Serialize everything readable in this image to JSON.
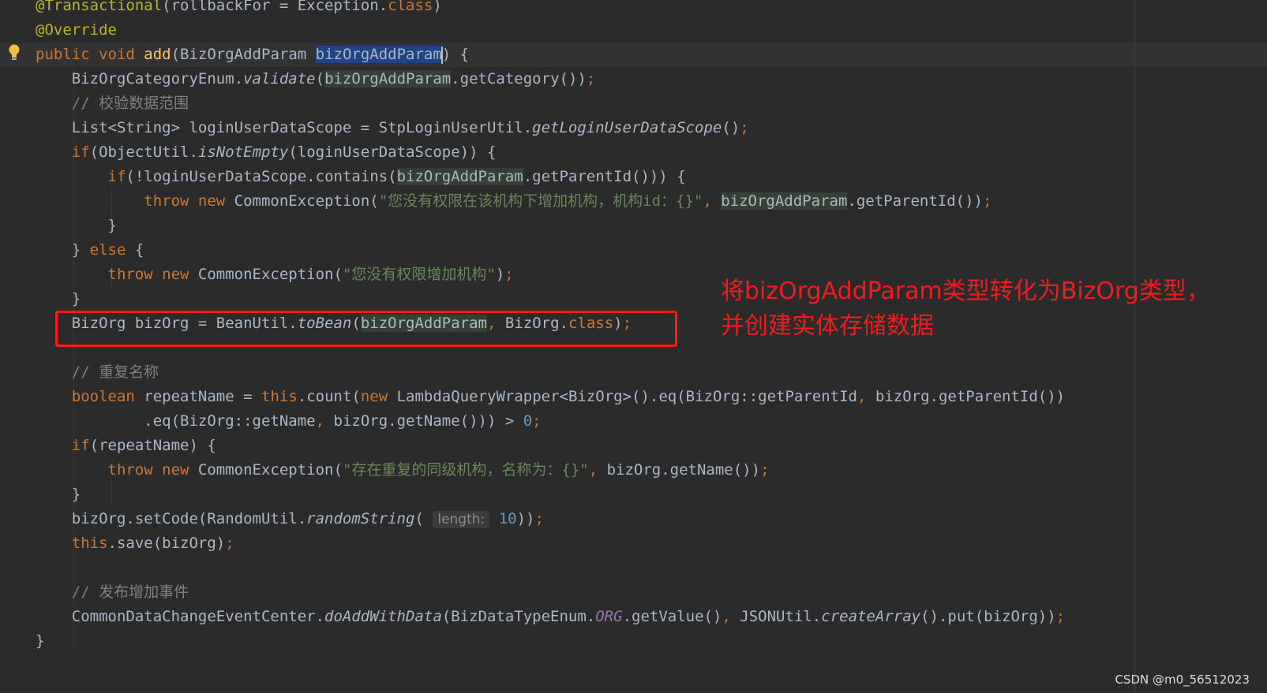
{
  "editor": {
    "lines": [
      [
        {
          "t": "@Transactional",
          "c": "ann"
        },
        {
          "t": "(rollbackFor = Exception."
        },
        {
          "t": "class",
          "c": "k"
        },
        {
          "t": ")"
        }
      ],
      [
        {
          "t": "@Override",
          "c": "ann"
        }
      ],
      [
        {
          "t": "public void ",
          "c": "k"
        },
        {
          "t": "add",
          "c": "fn"
        },
        {
          "t": "(BizOrgAddParam "
        },
        {
          "t": "bizOrgAddParam",
          "c": "hl-sel",
          "caret": true
        },
        {
          "t": ") {"
        }
      ],
      [
        {
          "t": "    BizOrgCategoryEnum."
        },
        {
          "t": "validate",
          "c": "it"
        },
        {
          "t": "("
        },
        {
          "t": "bizOrgAddParam",
          "c": "hl-usage"
        },
        {
          "t": ".getCategory())"
        },
        {
          "t": ";",
          "c": "k"
        }
      ],
      [
        {
          "t": "    // 校验数据范围",
          "c": "cm"
        }
      ],
      [
        {
          "t": "    List<String> loginUserDataScope = StpLoginUserUtil."
        },
        {
          "t": "getLoginUserDataScope",
          "c": "it"
        },
        {
          "t": "()"
        },
        {
          "t": ";",
          "c": "k"
        }
      ],
      [
        {
          "t": "    "
        },
        {
          "t": "if",
          "c": "k"
        },
        {
          "t": "(ObjectUtil."
        },
        {
          "t": "isNotEmpty",
          "c": "it"
        },
        {
          "t": "(loginUserDataScope)) {"
        }
      ],
      [
        {
          "t": "        "
        },
        {
          "t": "if",
          "c": "k"
        },
        {
          "t": "(!loginUserDataScope.contains("
        },
        {
          "t": "bizOrgAddParam",
          "c": "hl-usage"
        },
        {
          "t": ".getParentId())) {"
        }
      ],
      [
        {
          "t": "            "
        },
        {
          "t": "throw new ",
          "c": "k"
        },
        {
          "t": "CommonException("
        },
        {
          "t": "\"您没有权限在该机构下增加机构，机构id：{}\"",
          "c": "str"
        },
        {
          "t": ", ",
          "c": "k"
        },
        {
          "t": "bizOrgAddParam",
          "c": "hl-usage"
        },
        {
          "t": ".getParentId())"
        },
        {
          "t": ";",
          "c": "k"
        }
      ],
      [
        {
          "t": "        }"
        }
      ],
      [
        {
          "t": "    } "
        },
        {
          "t": "else",
          "c": "k"
        },
        {
          "t": " {"
        }
      ],
      [
        {
          "t": "        "
        },
        {
          "t": "throw new ",
          "c": "k"
        },
        {
          "t": "CommonException("
        },
        {
          "t": "\"您没有权限增加机构\"",
          "c": "str"
        },
        {
          "t": ")"
        },
        {
          "t": ";",
          "c": "k"
        }
      ],
      [
        {
          "t": "    }"
        }
      ],
      [
        {
          "t": "    BizOrg bizOrg = BeanUtil."
        },
        {
          "t": "toBean",
          "c": "it"
        },
        {
          "t": "("
        },
        {
          "t": "bizOrgAddParam",
          "c": "hl-usage"
        },
        {
          "t": ", ",
          "c": "k"
        },
        {
          "t": "BizOrg."
        },
        {
          "t": "class",
          "c": "k"
        },
        {
          "t": ")"
        },
        {
          "t": ";",
          "c": "k"
        }
      ],
      [],
      [
        {
          "t": "    // 重复名称",
          "c": "cm"
        }
      ],
      [
        {
          "t": "    "
        },
        {
          "t": "boolean ",
          "c": "k"
        },
        {
          "t": "repeatName = "
        },
        {
          "t": "this",
          "c": "k"
        },
        {
          "t": ".count("
        },
        {
          "t": "new ",
          "c": "k"
        },
        {
          "t": "LambdaQueryWrapper<BizOrg>().eq(BizOrg::getParentId"
        },
        {
          "t": ", ",
          "c": "k"
        },
        {
          "t": "bizOrg.getParentId())"
        }
      ],
      [
        {
          "t": "            .eq(BizOrg::getName"
        },
        {
          "t": ", ",
          "c": "k"
        },
        {
          "t": "bizOrg.getName())) > "
        },
        {
          "t": "0",
          "c": "num"
        },
        {
          "t": ";",
          "c": "k"
        }
      ],
      [
        {
          "t": "    "
        },
        {
          "t": "if",
          "c": "k"
        },
        {
          "t": "(repeatName) {"
        }
      ],
      [
        {
          "t": "        "
        },
        {
          "t": "throw new ",
          "c": "k"
        },
        {
          "t": "CommonException("
        },
        {
          "t": "\"存在重复的同级机构，名称为：{}\"",
          "c": "str"
        },
        {
          "t": ", ",
          "c": "k"
        },
        {
          "t": "bizOrg.getName())"
        },
        {
          "t": ";",
          "c": "k"
        }
      ],
      [
        {
          "t": "    }"
        }
      ],
      [
        {
          "t": "    bizOrg.setCode(RandomUtil."
        },
        {
          "t": "randomString",
          "c": "it"
        },
        {
          "t": "( "
        },
        {
          "t": "length:",
          "c": "hint"
        },
        {
          "t": " "
        },
        {
          "t": "10",
          "c": "num"
        },
        {
          "t": "))"
        },
        {
          "t": ";",
          "c": "k"
        }
      ],
      [
        {
          "t": "    "
        },
        {
          "t": "this",
          "c": "k"
        },
        {
          "t": ".save(bizOrg)"
        },
        {
          "t": ";",
          "c": "k"
        }
      ],
      [],
      [
        {
          "t": "    // 发布增加事件",
          "c": "cm"
        }
      ],
      [
        {
          "t": "    CommonDataChangeEventCenter."
        },
        {
          "t": "doAddWithData",
          "c": "it"
        },
        {
          "t": "(BizDataTypeEnum."
        },
        {
          "t": "ORG",
          "c": "cst"
        },
        {
          "t": ".getValue()"
        },
        {
          "t": ", ",
          "c": "k"
        },
        {
          "t": "JSONUtil."
        },
        {
          "t": "createArray",
          "c": "it"
        },
        {
          "t": "().put(bizOrg))"
        },
        {
          "t": ";",
          "c": "k"
        }
      ],
      [
        {
          "t": "}"
        }
      ]
    ]
  },
  "annotation": {
    "line1": "将bizOrgAddParam类型转化为BizOrg类型，",
    "line2": "并创建实体存储数据"
  },
  "watermark": "CSDN @m0_56512023",
  "icons": {
    "gutter": "lightbulb-icon"
  },
  "colors": {
    "highlight_box": "#ff1a1a",
    "annotation_text": "#f11c1c"
  }
}
